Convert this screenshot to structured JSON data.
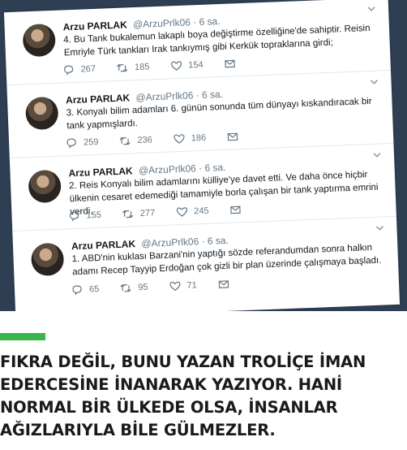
{
  "tweets": [
    {
      "name": "Arzu PARLAK",
      "handle_time": "@ArzuPrlk06 · 6 sa.",
      "text": "4. Bu Tank bukalemun lakaplı boya değiştirme özelliğine'de sahiptir. Reisin Emriyle Türk tankları Irak tankıymış gibi Kerkük topraklarına girdi;",
      "replies": "267",
      "retweets": "185",
      "likes": "154"
    },
    {
      "name": "Arzu PARLAK",
      "handle_time": "@ArzuPrlk06 · 6 sa.",
      "text": "3. Konyalı bilim adamları 6. günün sonunda tüm dünyayı kıskandıracak bir tank yapmışlardı.",
      "replies": "259",
      "retweets": "236",
      "likes": "186"
    },
    {
      "name": "Arzu PARLAK",
      "handle_time": "@ArzuPrlk06 · 6 sa.",
      "text": "2. Reis Konyalı bilim adamlarını külliye'ye davet etti. Ve daha önce hiçbir ülkenin cesaret edemediği tamamiyle borla çalışan bir tank yaptırma emrini verdi.",
      "replies": "155",
      "retweets": "277",
      "likes": "245"
    },
    {
      "name": "Arzu PARLAK",
      "handle_time": "@ArzuPrlk06 · 6 sa.",
      "text": "1. ABD'nin kuklası Barzani'nin yaptığı sözde referandumdan sonra halkın adamı Recep Tayyip Erdoğan çok gizli bir plan üzerinde çalışmaya başladı.",
      "replies": "65",
      "retweets": "95",
      "likes": "71"
    }
  ],
  "caption": {
    "lines": [
      "FIKRA DEĞİL, BUNU YAZAN TROLİÇE İMAN",
      "EDERCESİNE İNANARAK YAZIYOR. HANİ",
      "NORMAL BİR ÜLKEDE OLSA, İNSANLAR",
      "AĞIZLARIYLA BİLE GÜLMEZLER."
    ]
  },
  "colors": {
    "accent_bar": "#39b54a",
    "photo_background": "#2e3f54",
    "caption_text": "#1a1a1a"
  },
  "icons": [
    "reply-icon",
    "retweet-icon",
    "like-icon",
    "dm-icon",
    "chevron-down-icon"
  ]
}
